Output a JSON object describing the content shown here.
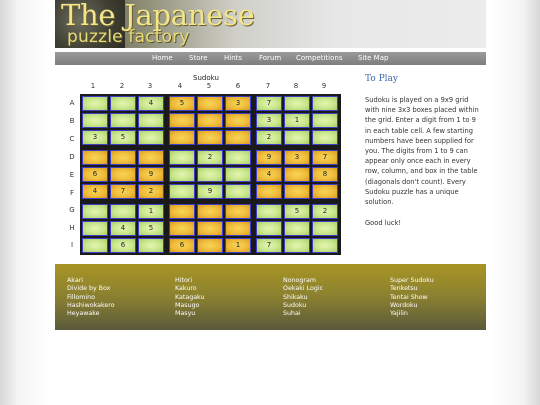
{
  "header": {
    "logo_line1": "The Japanese",
    "logo_line2": "puzzle factory"
  },
  "nav": [
    "Home",
    "Store",
    "Hints",
    "Forum",
    "Competitions",
    "Site Map"
  ],
  "puzzle": {
    "title": "Sudoku",
    "col_labels": [
      "1",
      "2",
      "3",
      "4",
      "5",
      "6",
      "7",
      "8",
      "9"
    ],
    "row_labels": [
      "A",
      "B",
      "C",
      "D",
      "E",
      "F",
      "G",
      "H",
      "I"
    ],
    "grid": [
      [
        "",
        "",
        "4",
        "5",
        "",
        "3",
        "7",
        "",
        ""
      ],
      [
        "",
        "",
        "",
        "",
        "",
        "",
        "3",
        "1",
        ""
      ],
      [
        "3",
        "5",
        "",
        "",
        "",
        "",
        "2",
        "",
        ""
      ],
      [
        "",
        "",
        "",
        "",
        "2",
        "",
        "9",
        "3",
        "7"
      ],
      [
        "6",
        "",
        "9",
        "",
        "",
        "",
        "4",
        "",
        "8"
      ],
      [
        "4",
        "7",
        "2",
        "",
        "9",
        "",
        "",
        "",
        ""
      ],
      [
        "",
        "",
        "1",
        "",
        "",
        "",
        "",
        "5",
        "2"
      ],
      [
        "",
        "4",
        "5",
        "",
        "",
        "",
        "",
        "",
        ""
      ],
      [
        "",
        "6",
        "",
        "6",
        "",
        "1",
        "7",
        "",
        ""
      ]
    ]
  },
  "sidebar": {
    "title": "To Play",
    "body": "Sudoku is played on a 9x9 grid with nine 3x3 boxes placed within the grid. Enter a digit from 1 to 9 in each table cell. A few starting numbers have been supplied for you. The digits from 1 to 9 can appear only once each in every row, column, and box in the table (diagonals don't count). Every Sudoku puzzle has a unique solution.",
    "closing": "Good luck!"
  },
  "footer": {
    "columns": [
      [
        "Akari",
        "Divide by Box",
        "Fillomino",
        "Hashiwokakero",
        "Heyawake"
      ],
      [
        "Hitori",
        "Kakuro",
        "Katagaku",
        "Masugo",
        "Masyu"
      ],
      [
        "Nonogram",
        "Oekaki Logic",
        "Shikaku",
        "Sudoku",
        "Suhai"
      ],
      [
        "Super Sudoku",
        "Tenketsu",
        "Tentai Show",
        "Wordoku",
        "Yajilin"
      ]
    ]
  },
  "colors": {
    "cell_green": "#c9e68c",
    "cell_orange": "#efbc3a",
    "cell_border": "#3e3ec8",
    "title_blue": "#3a6aa8"
  }
}
